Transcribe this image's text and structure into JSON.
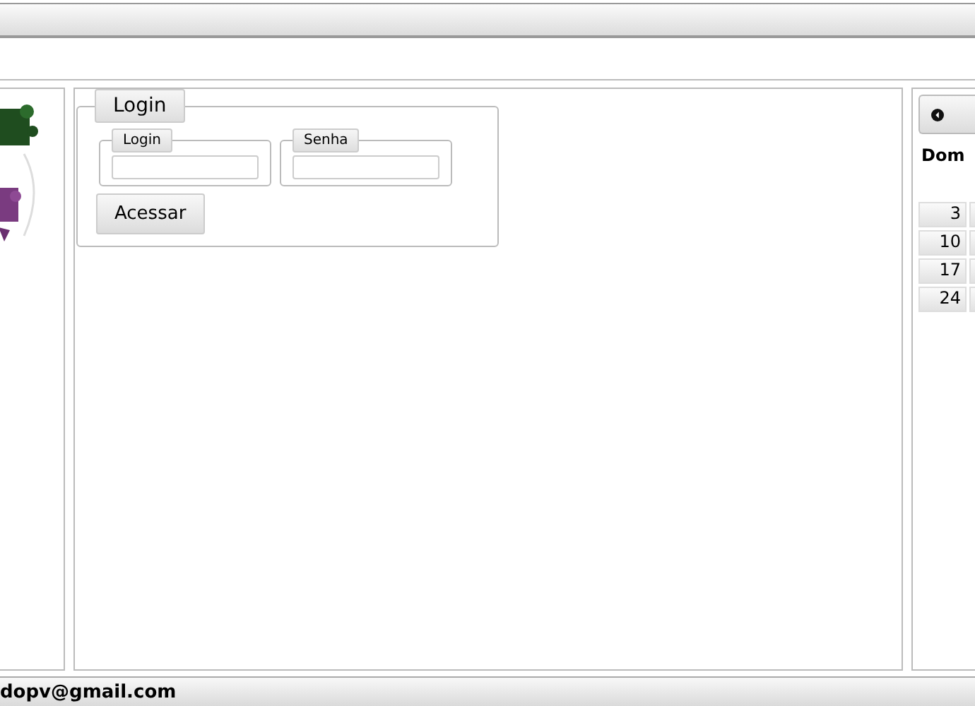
{
  "login_panel": {
    "legend": "Login",
    "fields": [
      {
        "label": "Login"
      },
      {
        "label": "Senha"
      }
    ],
    "submit": "Acessar"
  },
  "calendar": {
    "weekday_header": "Dom",
    "first_column_days": [
      "3",
      "10",
      "17",
      "24"
    ]
  },
  "footer": {
    "email": "dopv@gmail.com"
  }
}
